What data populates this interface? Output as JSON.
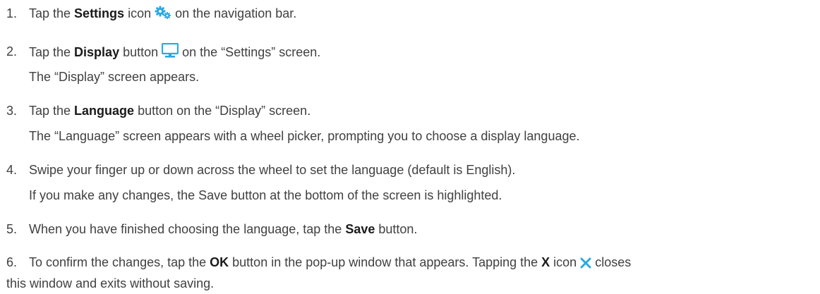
{
  "steps": [
    {
      "number": "1.",
      "pre": "Tap the ",
      "bold": "Settings",
      "mid": " icon",
      "icon": "settings-gears-icon",
      "post": " on the navigation bar."
    },
    {
      "number": "2.",
      "pre": "Tap the ",
      "bold": "Display",
      "mid": " button",
      "icon": "display-monitor-icon",
      "post": " on the “Settings” screen.",
      "note": "The “Display” screen appears."
    },
    {
      "number": "3.",
      "pre": "Tap the ",
      "bold": "Language",
      "post": " button on the “Display” screen.",
      "note": "The “Language” screen appears with a wheel picker, prompting you to choose a display language."
    },
    {
      "number": "4.",
      "pre": "Swipe your finger up or down across the wheel to set the language (default is English).",
      "note": "If you make any changes, the Save button at the bottom of the screen is highlighted."
    },
    {
      "number": "5.",
      "pre": "When you have finished choosing the language, tap the ",
      "bold": "Save",
      "post": " button."
    },
    {
      "number": "6.",
      "pre": "To confirm the changes, tap the ",
      "bold": "OK",
      "mid": " button in the pop-up window that appears. Tapping the ",
      "bold2": "X",
      "mid2": " icon",
      "icon": "close-x-icon",
      "post": " closes",
      "note": "this window and exits without saving."
    }
  ],
  "colors": {
    "icon_blue": "#2aa9e0",
    "text": "#404040",
    "bold_text": "#1a1a1a"
  }
}
